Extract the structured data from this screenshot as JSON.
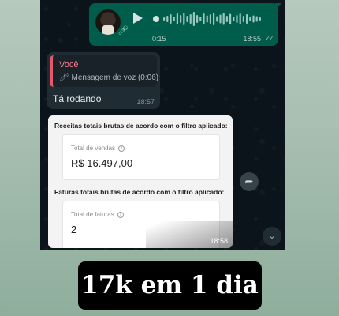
{
  "voice_message": {
    "duration": "0:15",
    "time": "18:55",
    "status_ticks": "✓✓",
    "mic_icon": "microphone-icon",
    "play_icon": "play-icon"
  },
  "reply_message": {
    "quoted_author": "Você",
    "quoted_text": "Mensagem de voz (0:06)",
    "text": "Tá rodando",
    "time": "18:57"
  },
  "screenshot": {
    "section1_heading": "Receitas totais brutas de acordo com o filtro aplicado:",
    "section1_label": "Total de vendas",
    "section1_value": "R$ 16.497,00",
    "section2_heading": "Faturas totais brutas de acordo com o filtro aplicado:",
    "section2_label": "Total de faturas",
    "section2_value": "2",
    "time": "18:58",
    "info_icon": "info-icon"
  },
  "buttons": {
    "forward_icon": "forward-icon",
    "scroll_down_icon": "chevron-down-icon"
  },
  "caption": "17k em 1 dia",
  "colors": {
    "outgoing_bubble": "#005c4b",
    "incoming_bubble": "#1f2c33",
    "chat_background": "#0b141a",
    "quote_accent": "#e9566d"
  }
}
